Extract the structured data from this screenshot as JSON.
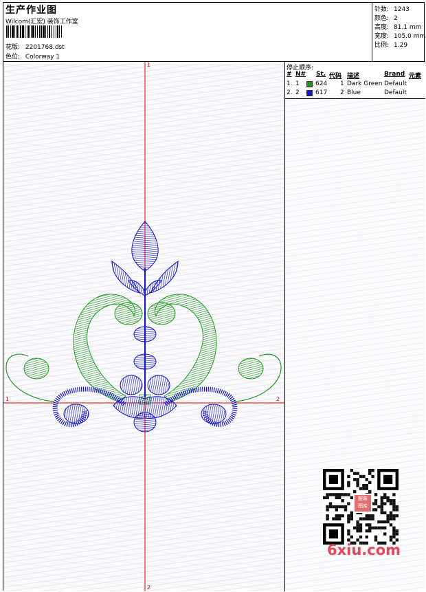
{
  "header": {
    "title": "生产作业图",
    "company": "Wilcom(汇宏) 装饰工作室",
    "design_label": "花版:",
    "design_value": "2201768.dst",
    "colorway_label": "色位:",
    "colorway_value": "Colorway 1"
  },
  "stats": {
    "stitches_label": "针数:",
    "stitches_value": "1243",
    "colors_label": "颜色:",
    "colors_value": "2",
    "height_label": "高度:",
    "height_value": "81.1 mm",
    "width_label": "宽度:",
    "width_value": "105.0 mm",
    "scale_label": "比例:",
    "scale_value": "1.29"
  },
  "axes": {
    "top": "1",
    "bottom": "2",
    "left": "1",
    "right": "2"
  },
  "stop_sequence": {
    "title": "停止顺序:",
    "headers": [
      "#",
      "N#",
      "St.",
      "代码",
      "描述",
      "Brand",
      "元素"
    ],
    "rows": [
      {
        "idx": "1.",
        "n": "1",
        "color": "#1a9a1a",
        "st": "624",
        "code": "1",
        "desc": "Dark Green",
        "brand": "Default"
      },
      {
        "idx": "2.",
        "n": "2",
        "color": "#1010e0",
        "st": "617",
        "code": "2",
        "desc": "Blue",
        "brand": "Default"
      }
    ]
  },
  "qr": {
    "badge_line1": "服装",
    "badge_line2": "图库"
  },
  "watermark": "6xiu.com",
  "colors": {
    "green": "#1f9a1f",
    "blue": "#1212d8",
    "axis": "#e00000"
  }
}
